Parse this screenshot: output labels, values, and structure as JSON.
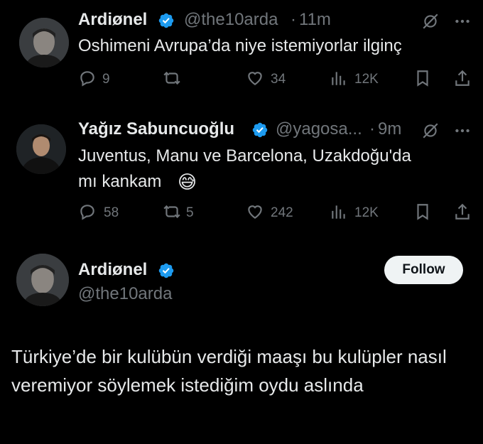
{
  "tweet1": {
    "name": "Ardiønel",
    "handle": "@the10arda",
    "time_sep": "·",
    "time": "11m",
    "text": "Oshimeni Avrupa’da niye istemiyorlar ilginç",
    "replies": "9",
    "retweets": "",
    "likes": "34",
    "views": "12K"
  },
  "tweet2": {
    "name": "Yağız Sabuncuoğlu",
    "handle": "@yagosa...",
    "time_sep": "·",
    "time": "9m",
    "text_line1": "Juventus, Manu ve Barcelona, Uzakdoğu'da",
    "text_line2": "mı kankam",
    "emoji": "😅",
    "replies": "58",
    "retweets": "5",
    "likes": "242",
    "views": "12K"
  },
  "main_tweet": {
    "name": "Ardiønel",
    "handle": "@the10arda",
    "follow_label": "Follow",
    "text": "Türkiye’de bir kulübün verdiği maaşı bu kulüpler nasıl veremiyor söylemek istediğim oydu aslında"
  },
  "colors": {
    "background": "#000000",
    "text": "#e7e9ea",
    "muted": "#71767b",
    "verified": "#1d9bf0",
    "button_bg": "#eff3f4"
  },
  "icons": [
    "reply-icon",
    "retweet-icon",
    "like-icon",
    "views-icon",
    "bookmark-icon",
    "share-icon",
    "grok-icon",
    "more-icon",
    "verified-badge-icon"
  ]
}
